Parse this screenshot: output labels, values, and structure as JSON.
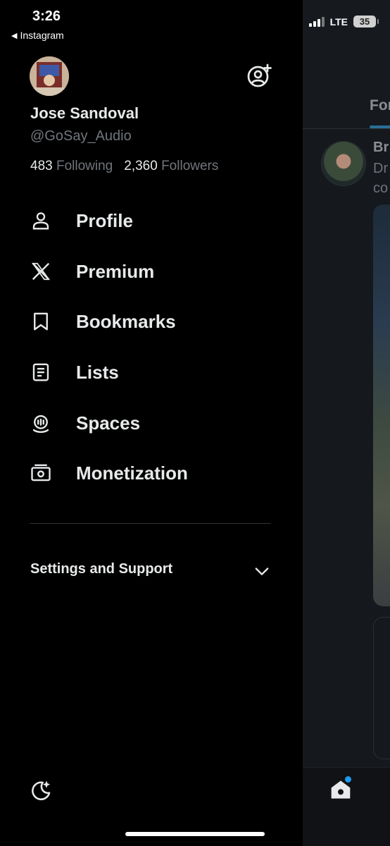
{
  "status_bar": {
    "time": "3:26",
    "back_app": "Instagram",
    "network": "LTE",
    "battery": "35"
  },
  "profile": {
    "name": "Jose Sandoval",
    "handle": "@GoSay_Audio",
    "following_count": "483",
    "following_label": "Following",
    "followers_count": "2,360",
    "followers_label": "Followers"
  },
  "menu": {
    "items": [
      {
        "label": "Profile",
        "icon": "person-icon"
      },
      {
        "label": "Premium",
        "icon": "x-logo-icon"
      },
      {
        "label": "Bookmarks",
        "icon": "bookmark-icon"
      },
      {
        "label": "Lists",
        "icon": "list-icon"
      },
      {
        "label": "Spaces",
        "icon": "spaces-icon"
      },
      {
        "label": "Monetization",
        "icon": "money-icon"
      }
    ]
  },
  "settings": {
    "label": "Settings and Support"
  },
  "timeline": {
    "tab_label": "For",
    "tweet_name": "Br",
    "tweet_line1": "Dr",
    "tweet_line2": "co"
  },
  "colors": {
    "background": "#000000",
    "text_primary": "#e7e9ea",
    "text_secondary": "#71767b",
    "accent": "#1d9bf0"
  }
}
